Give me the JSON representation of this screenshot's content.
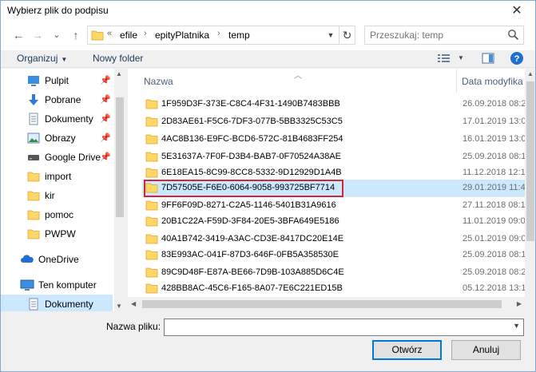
{
  "window": {
    "title": "Wybierz plik do podpisu",
    "close_glyph": "✕"
  },
  "nav": {
    "back_glyph": "←",
    "forward_glyph": "→",
    "recent_glyph": "⌄",
    "up_glyph": "↑",
    "breadcrumb": [
      "«",
      "efile",
      "epityPlatnika",
      "temp"
    ],
    "search_placeholder": "Przeszukaj: temp"
  },
  "toolbar": {
    "organize": "Organizuj",
    "new_folder": "Nowy folder"
  },
  "sidebar": {
    "items": [
      {
        "label": "Pulpit",
        "icon": "desktop-icon",
        "pinned": true
      },
      {
        "label": "Pobrane",
        "icon": "download-icon",
        "pinned": true
      },
      {
        "label": "Dokumenty",
        "icon": "documents-icon",
        "pinned": true
      },
      {
        "label": "Obrazy",
        "icon": "pictures-icon",
        "pinned": true
      },
      {
        "label": "Google Drive",
        "icon": "drive-icon",
        "pinned": true
      },
      {
        "label": "import",
        "icon": "folder-icon",
        "pinned": false
      },
      {
        "label": "kir",
        "icon": "folder-icon",
        "pinned": false
      },
      {
        "label": "pomoc",
        "icon": "folder-icon",
        "pinned": false
      },
      {
        "label": "PWPW",
        "icon": "folder-icon",
        "pinned": false
      },
      {
        "label": "OneDrive",
        "icon": "cloud-icon",
        "pinned": false
      },
      {
        "label": "Ten komputer",
        "icon": "computer-icon",
        "pinned": false
      },
      {
        "label": "Dokumenty",
        "icon": "documents-icon",
        "pinned": false,
        "selected": true
      }
    ]
  },
  "filelist": {
    "columns": {
      "name": "Nazwa",
      "date": "Data modyfika"
    },
    "rows": [
      {
        "name": "1F959D3F-373E-C8C4-4F31-1490B7483BBB",
        "date": "26.09.2018 08:2"
      },
      {
        "name": "2D83AE61-F5C6-7DF3-077B-5BB3325C53C5",
        "date": "17.01.2019 13:0"
      },
      {
        "name": "4AC8B136-E9FC-BCD6-572C-81B4683FF254",
        "date": "16.01.2019 13:0"
      },
      {
        "name": "5E31637A-7F0F-D3B4-BAB7-0F70524A38AE",
        "date": "25.09.2018 08:1"
      },
      {
        "name": "6E18EA15-8C99-8CC8-5332-9D12929D1A4B",
        "date": "11.12.2018 12:1"
      },
      {
        "name": "7D57505E-F6E0-6064-9058-993725BF7714",
        "date": "29.01.2019 11:4",
        "selected": true
      },
      {
        "name": "9FF6F09D-8271-C2A5-1146-5401B31A9616",
        "date": "27.11.2018 08:1"
      },
      {
        "name": "20B1C22A-F59D-3F84-20E5-3BFA649E5186",
        "date": "11.01.2019 09:0"
      },
      {
        "name": "40A1B742-3419-A3AC-CD3E-8417DC20E14E",
        "date": "25.01.2019 09:0"
      },
      {
        "name": "83E993AC-041F-87D3-646F-0FB5A358530E",
        "date": "25.09.2018 08:1"
      },
      {
        "name": "89C9D48F-E87A-BE66-7D9B-103A885D6C4E",
        "date": "25.09.2018 08:2"
      },
      {
        "name": "428BB8AC-45C6-F165-8A07-7E6C221ED15B",
        "date": "05.12.2018 13:1"
      }
    ]
  },
  "footer": {
    "filename_label": "Nazwa pliku:",
    "filename_value": "",
    "open_label": "Otwórz",
    "cancel_label": "Anuluj"
  },
  "colors": {
    "selection": "#cce8ff",
    "highlight_border": "#d3253a",
    "folder": "#ffd766",
    "accent": "#0078d7"
  }
}
